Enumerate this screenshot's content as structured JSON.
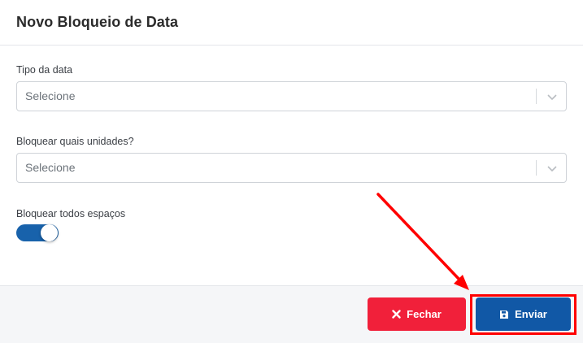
{
  "modal": {
    "title": "Novo Bloqueio de Data"
  },
  "fields": {
    "tipo_data": {
      "label": "Tipo da data",
      "value": "Selecione"
    },
    "unidades": {
      "label": "Bloquear quais unidades?",
      "value": "Selecione"
    },
    "todos_espacos": {
      "label": "Bloquear todos espaços",
      "checked": true
    }
  },
  "footer": {
    "close_label": "Fechar",
    "send_label": "Enviar"
  },
  "icons": {
    "close": "times-icon",
    "send": "floppy-disk-icon",
    "dropdown": "chevron-down-icon"
  },
  "colors": {
    "primary": "#1158a6",
    "danger": "#f1203a",
    "toggle_on": "#1862ab",
    "annotation": "#ff0000"
  }
}
